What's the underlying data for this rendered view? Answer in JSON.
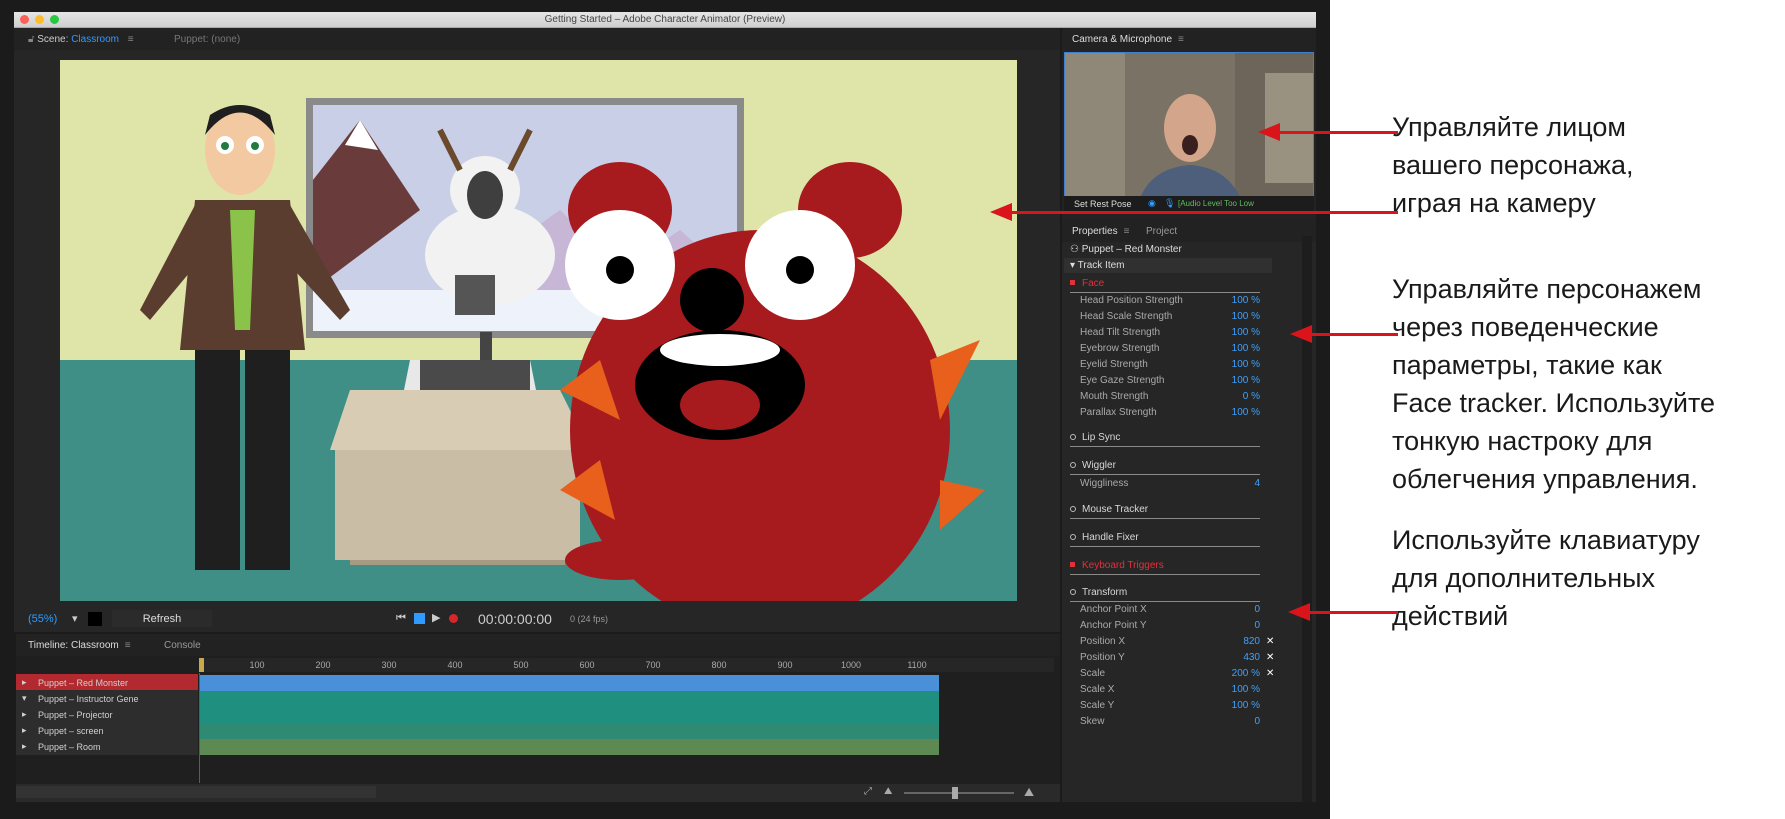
{
  "window": {
    "title": "Getting Started – Adobe Character Animator (Preview)"
  },
  "scene_panel": {
    "scene_label": "Scene:",
    "scene_name": "Classroom",
    "puppet_tab": "Puppet: (none)",
    "zoom": "(55%)",
    "refresh": "Refresh",
    "timecode": "00:00:00:00",
    "fps": "0 (24 fps)"
  },
  "timeline": {
    "tab_label": "Timeline: Classroom",
    "console_tab": "Console",
    "ticks": [
      "100",
      "200",
      "300",
      "400",
      "500",
      "600",
      "700",
      "800",
      "900",
      "1000",
      "1100"
    ],
    "tracks": [
      {
        "label": "Puppet – Red Monster",
        "color": "#4a90d9",
        "selected": true,
        "expanded": false
      },
      {
        "label": "Puppet – Instructor Gene",
        "color": "#1f8f7f",
        "selected": false,
        "expanded": true
      },
      {
        "label": "Puppet – Projector",
        "color": "#1f8f7f",
        "selected": false,
        "expanded": false
      },
      {
        "label": "Puppet – screen",
        "color": "#2f8a74",
        "selected": false,
        "expanded": false
      },
      {
        "label": "Puppet – Room",
        "color": "#5c8a52",
        "selected": false,
        "expanded": false
      }
    ]
  },
  "camera_panel": {
    "title": "Camera & Microphone",
    "set_rest_pose": "Set Rest Pose",
    "audio_status": "[Audio Level Too Low"
  },
  "properties_panel": {
    "tab_properties": "Properties",
    "tab_project": "Project",
    "puppet_title": "Puppet – Red Monster",
    "track_item": "Track Item",
    "face_section": "Face",
    "face_params": [
      {
        "name": "Head Position Strength",
        "value": "100 %"
      },
      {
        "name": "Head Scale Strength",
        "value": "100 %"
      },
      {
        "name": "Head Tilt Strength",
        "value": "100 %"
      },
      {
        "name": "Eyebrow Strength",
        "value": "100 %"
      },
      {
        "name": "Eyelid Strength",
        "value": "100 %"
      },
      {
        "name": "Eye Gaze Strength",
        "value": "100 %"
      },
      {
        "name": "Mouth Strength",
        "value": "0 %"
      },
      {
        "name": "Parallax Strength",
        "value": "100 %"
      }
    ],
    "lip_sync": "Lip Sync",
    "wiggler": "Wiggler",
    "wiggliness_label": "Wiggliness",
    "wiggliness_value": "4",
    "mouse_tracker": "Mouse Tracker",
    "handle_fixer": "Handle Fixer",
    "keyboard_triggers": "Keyboard Triggers",
    "transform": "Transform",
    "transform_params": [
      {
        "name": "Anchor Point X",
        "value": "0",
        "x": false
      },
      {
        "name": "Anchor Point Y",
        "value": "0",
        "x": false
      },
      {
        "name": "Position X",
        "value": "820",
        "x": true
      },
      {
        "name": "Position Y",
        "value": "430",
        "x": true
      },
      {
        "name": "Scale",
        "value": "200 %",
        "x": true
      },
      {
        "name": "Scale X",
        "value": "100 %",
        "x": false
      },
      {
        "name": "Scale Y",
        "value": "100 %",
        "x": false
      },
      {
        "name": "Skew",
        "value": "0",
        "x": false
      }
    ]
  },
  "annotations": [
    {
      "lines": [
        "Управляйте лицом",
        "вашего персонажа,",
        "играя на камеру"
      ]
    },
    {
      "lines": [
        "Управляйте персонажем",
        "через поведенческие",
        "параметры, такие как",
        "Face tracker. Используйте",
        "тонкую настроку для",
        "облегчения управления."
      ]
    },
    {
      "lines": [
        "Используйте клавиатуру",
        "для дополнительных",
        "действий"
      ]
    }
  ],
  "colors": {
    "accent": "#2f9bff",
    "annotation_arrow": "#d9141b",
    "warning": "#e0323a"
  }
}
